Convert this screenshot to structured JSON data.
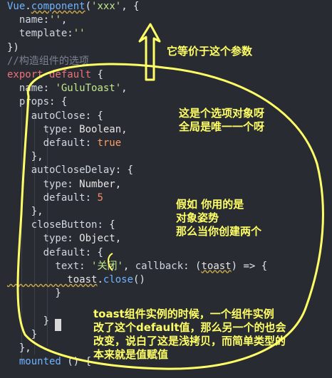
{
  "code_lines": [
    {
      "parts": [
        [
          "fn",
          "Vue"
        ],
        [
          "k",
          "."
        ],
        [
          "fn under",
          "component"
        ],
        [
          "k",
          "("
        ],
        [
          "str",
          "'xxx'"
        ],
        [
          "k",
          ", {"
        ]
      ]
    },
    {
      "parts": [
        [
          "prop",
          "  name"
        ],
        [
          "k",
          ":"
        ],
        [
          "str",
          "''"
        ],
        [
          "k",
          ","
        ]
      ]
    },
    {
      "parts": [
        [
          "prop",
          "  template"
        ],
        [
          "k",
          ":"
        ],
        [
          "str",
          "''"
        ]
      ]
    },
    {
      "parts": [
        [
          "k",
          "})"
        ]
      ]
    },
    {
      "parts": [
        [
          "cm",
          "//构造组件的选项"
        ]
      ]
    },
    {
      "parts": [
        [
          "kw",
          "export default"
        ],
        [
          "k",
          " {"
        ]
      ]
    },
    {
      "parts": [
        [
          "prop",
          "  name"
        ],
        [
          "k",
          ": "
        ],
        [
          "str",
          "'GuluToast'"
        ],
        [
          "k",
          ","
        ]
      ]
    },
    {
      "parts": [
        [
          "prop",
          "  props"
        ],
        [
          "k",
          ": {"
        ]
      ]
    },
    {
      "parts": [
        [
          "prop",
          "    autoClose"
        ],
        [
          "k",
          ": {"
        ]
      ]
    },
    {
      "parts": [
        [
          "prop",
          "      type"
        ],
        [
          "k",
          ": "
        ],
        [
          "typ",
          "Boolean"
        ],
        [
          "k",
          ","
        ]
      ]
    },
    {
      "parts": [
        [
          "prop",
          "      default"
        ],
        [
          "k",
          ": "
        ],
        [
          "bool",
          "true"
        ]
      ]
    },
    {
      "parts": [
        [
          "k",
          "    },"
        ]
      ]
    },
    {
      "parts": [
        [
          "prop",
          "    autoCloseDelay"
        ],
        [
          "k",
          ": {"
        ]
      ]
    },
    {
      "parts": [
        [
          "prop",
          "      type"
        ],
        [
          "k",
          ": "
        ],
        [
          "typ",
          "Number"
        ],
        [
          "k",
          ","
        ]
      ]
    },
    {
      "parts": [
        [
          "prop",
          "      default"
        ],
        [
          "k",
          ": "
        ],
        [
          "num",
          "5"
        ]
      ]
    },
    {
      "parts": [
        [
          "k",
          "    },"
        ]
      ]
    },
    {
      "parts": [
        [
          "prop",
          "    closeButton"
        ],
        [
          "k",
          ": {"
        ]
      ]
    },
    {
      "parts": [
        [
          "prop",
          "      type"
        ],
        [
          "k",
          ": "
        ],
        [
          "typ",
          "Object"
        ],
        [
          "k",
          ","
        ]
      ]
    },
    {
      "parts": [
        [
          "prop",
          "      default"
        ],
        [
          "k",
          ": "
        ],
        [
          "k",
          "{"
        ]
      ]
    },
    {
      "parts": [
        [
          "prop",
          "        text"
        ],
        [
          "k",
          ": "
        ],
        [
          "str",
          "'关闭'"
        ],
        [
          "k",
          ", "
        ],
        [
          "prop",
          "callback"
        ],
        [
          "k",
          ": ("
        ],
        [
          "typ under",
          "toast"
        ],
        [
          "k",
          ") => {"
        ]
      ]
    },
    {
      "parts": [
        [
          "typ under",
          "          toast"
        ],
        [
          "k",
          "."
        ],
        [
          "fn",
          "close"
        ],
        [
          "k",
          "()"
        ]
      ]
    },
    {
      "parts": [
        [
          "k",
          "        }"
        ]
      ]
    },
    {
      "parts": [
        [
          "k",
          ""
        ]
      ]
    },
    {
      "parts": [
        [
          "k",
          "      }"
        ]
      ]
    },
    {
      "parts": [
        [
          "k",
          "    }"
        ]
      ]
    },
    {
      "parts": [
        [
          "k",
          "  },"
        ]
      ]
    },
    {
      "parts": [
        [
          "fn",
          "  mounted"
        ],
        [
          "k",
          " () {"
        ]
      ]
    }
  ],
  "annotations": {
    "equivalent": "它等价于这个参数",
    "options_object": "这是个选项对象呀\n全局是唯一一个呀",
    "if_object": "假如 你用的是\n对象姿势\n那么当你创建两个",
    "shallow_copy": "toast组件实例的时候，一个组件实例\n改了这个default值，那么另一个的也会\n改变，说白了这是浅拷贝，而简单类型的\n本来就是值赋值"
  },
  "colors": {
    "annotation": "#ffff66",
    "background": "#282b31"
  }
}
